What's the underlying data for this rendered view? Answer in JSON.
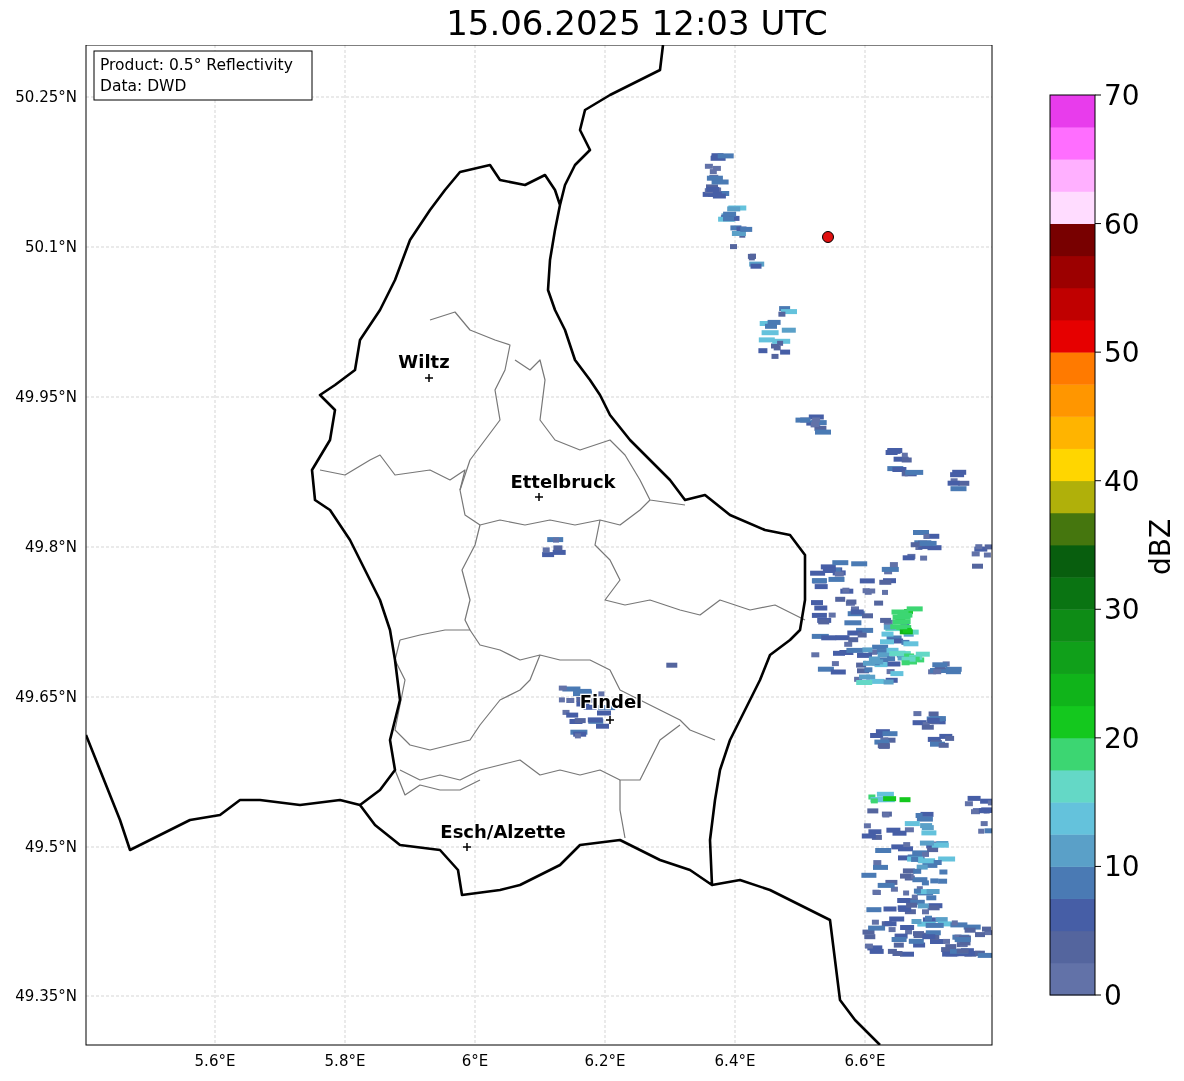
{
  "title": "15.06.2025 12:03 UTC",
  "info_box": [
    "Product: 0.5° Reflectivity",
    "Data: DWD"
  ],
  "map": {
    "lat_ticks": [
      "50.25°N",
      "50.1°N",
      "49.95°N",
      "49.8°N",
      "49.65°N",
      "49.5°N",
      "49.35°N"
    ],
    "lon_ticks": [
      "5.6°E",
      "5.8°E",
      "6°E",
      "6.2°E",
      "6.4°E",
      "6.6°E"
    ],
    "cities": [
      {
        "name": "Wiltz"
      },
      {
        "name": "Ettelbruck"
      },
      {
        "name": "Findel"
      },
      {
        "name": "Esch/Alzette"
      }
    ]
  },
  "colorbar": {
    "label": "dBZ",
    "ticks": [
      "70",
      "60",
      "50",
      "40",
      "30",
      "20",
      "10",
      "0"
    ],
    "segments": [
      {
        "color": "#6272a8"
      },
      {
        "color": "#54659e"
      },
      {
        "color": "#465ea6"
      },
      {
        "color": "#4a7ab4"
      },
      {
        "color": "#5aa0c8"
      },
      {
        "color": "#64c2dc"
      },
      {
        "color": "#64d8c6"
      },
      {
        "color": "#3cd672"
      },
      {
        "color": "#14c81e"
      },
      {
        "color": "#10b41a"
      },
      {
        "color": "#10a01a"
      },
      {
        "color": "#0e8c16"
      },
      {
        "color": "#0a7412"
      },
      {
        "color": "#085e0e"
      },
      {
        "color": "#45760e"
      },
      {
        "color": "#b0b00a"
      },
      {
        "color": "#ffd600"
      },
      {
        "color": "#ffb400"
      },
      {
        "color": "#ff9600"
      },
      {
        "color": "#ff7a00"
      },
      {
        "color": "#e60000"
      },
      {
        "color": "#c00000"
      },
      {
        "color": "#9c0000"
      },
      {
        "color": "#780000"
      },
      {
        "color": "#ffdcff"
      },
      {
        "color": "#ffb0ff"
      },
      {
        "color": "#ff6eff"
      },
      {
        "color": "#e83cec"
      }
    ]
  }
}
